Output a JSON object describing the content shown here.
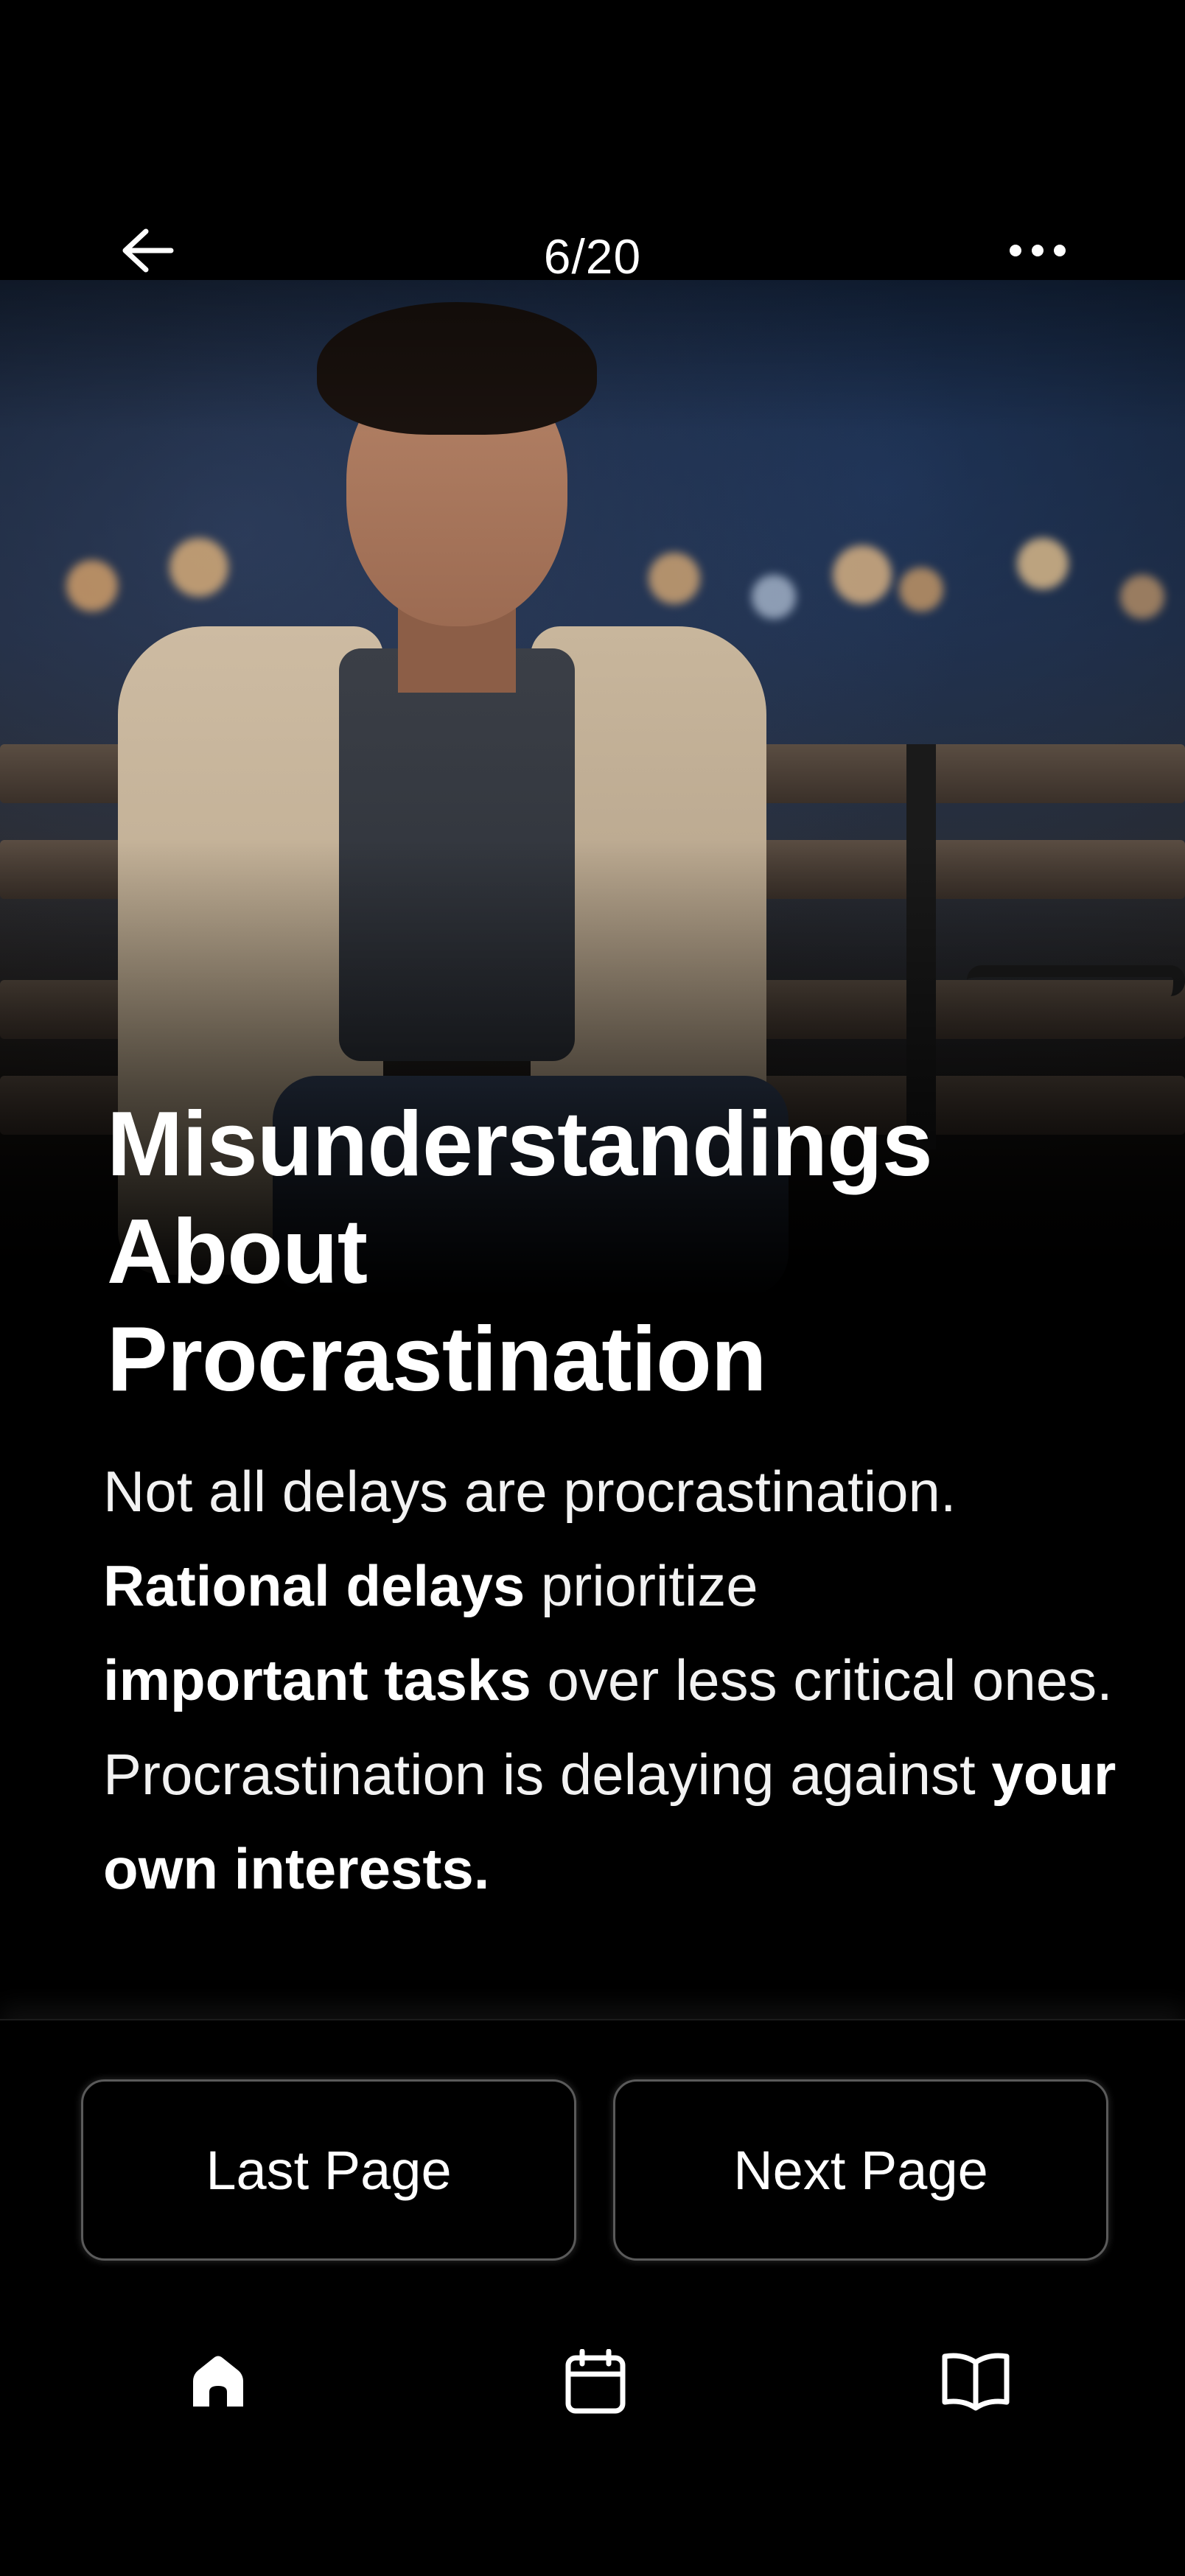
{
  "header": {
    "page_counter": "6/20",
    "back_icon": "arrow-left-icon",
    "more_icon": "more-horizontal-icon"
  },
  "content": {
    "title_lines": [
      "Misunderstandings",
      "About",
      "Procrastination"
    ],
    "body": {
      "s1": "Not all delays are procrastination.",
      "s2_bold": "Rational delays",
      "s2_rest": " prioritize",
      "s3_bold": "important tasks",
      "s3_rest": " over less critical ones. Procrastination is delaying against ",
      "s4_bold": "your own interests."
    }
  },
  "footer": {
    "last_page_label": "Last Page",
    "next_page_label": "Next Page",
    "tabs": [
      {
        "icon": "home-icon"
      },
      {
        "icon": "calendar-icon"
      },
      {
        "icon": "book-open-icon"
      }
    ]
  },
  "colors": {
    "background": "#000000",
    "text": "#ffffff",
    "button_border": "#5a5a5a"
  }
}
